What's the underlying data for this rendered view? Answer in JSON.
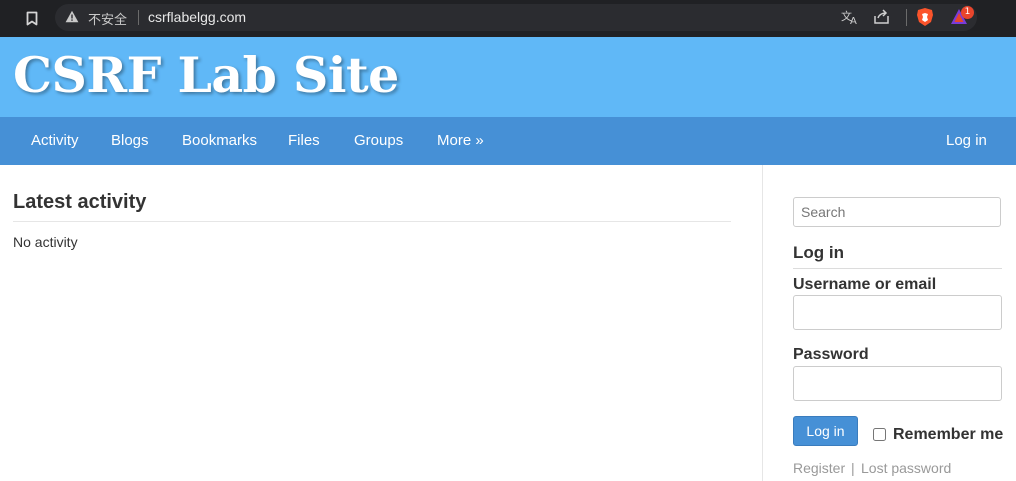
{
  "browser": {
    "security_label": "不安全",
    "url": "csrflabelgg.com",
    "rewards_badge": "1",
    "icons": {
      "bookmark": "bookmark-icon",
      "warning": "warning-icon",
      "translate": "translate-icon",
      "share": "share-icon",
      "brave": "brave-shield-icon",
      "rewards": "brave-rewards-icon"
    }
  },
  "site": {
    "title": "CSRF Lab Site",
    "colors": {
      "header": "#60b8f7",
      "nav": "#4690d6",
      "button": "#4690d6"
    }
  },
  "nav": {
    "items": [
      {
        "label": "Activity"
      },
      {
        "label": "Blogs"
      },
      {
        "label": "Bookmarks"
      },
      {
        "label": "Files"
      },
      {
        "label": "Groups"
      },
      {
        "label": "More »"
      }
    ],
    "login": "Log in"
  },
  "main": {
    "title": "Latest activity",
    "empty_text": "No activity"
  },
  "sidebar": {
    "search_placeholder": "Search",
    "login_title": "Log in",
    "username_label": "Username or email",
    "password_label": "Password",
    "login_button": "Log in",
    "remember_label": "Remember me",
    "register_link": "Register",
    "separator": "|",
    "lost_password_link": "Lost password"
  }
}
